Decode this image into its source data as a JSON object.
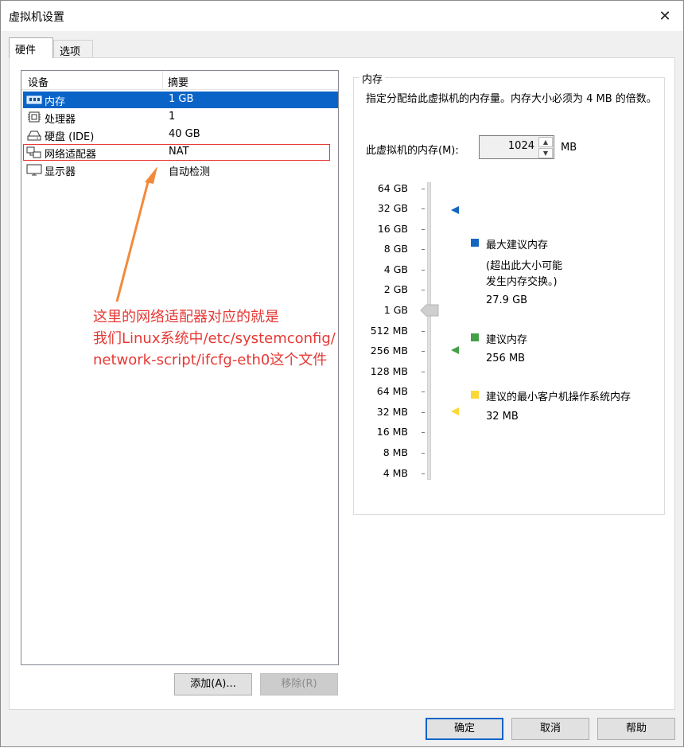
{
  "window": {
    "title": "虚拟机设置",
    "close_glyph": "✕"
  },
  "tabs": [
    {
      "label": "硬件",
      "active": true
    },
    {
      "label": "选项",
      "active": false
    }
  ],
  "device_list": {
    "headers": {
      "device": "设备",
      "summary": "摘要"
    },
    "rows": [
      {
        "icon": "memory-icon",
        "name": "内存",
        "summary": "1 GB",
        "selected": true
      },
      {
        "icon": "processor-icon",
        "name": "处理器",
        "summary": "1"
      },
      {
        "icon": "hard-disk-icon",
        "name": "硬盘 (IDE)",
        "summary": "40 GB"
      },
      {
        "icon": "network-adapter-icon",
        "name": "网络适配器",
        "summary": "NAT"
      },
      {
        "icon": "display-icon",
        "name": "显示器",
        "summary": "自动检测"
      }
    ],
    "add_button": "添加(A)...",
    "remove_button": "移除(R)"
  },
  "memory": {
    "group_title": "内存",
    "description": "指定分配给此虚拟机的内存量。内存大小必须为 4 MB 的倍数。",
    "label": "此虚拟机的内存(M):",
    "value": "1024",
    "unit": "MB",
    "scale": [
      "64 GB",
      "32 GB",
      "16 GB",
      "8 GB",
      "4 GB",
      "2 GB",
      "1 GB",
      "512 MB",
      "256 MB",
      "128 MB",
      "64 MB",
      "32 MB",
      "16 MB",
      "8 MB",
      "4 MB"
    ],
    "legend": {
      "max_title": "最大建议内存",
      "max_note_1": "(超出此大小可能",
      "max_note_2": "发生内存交换。)",
      "max_value": "27.9 GB",
      "rec_title": "建议内存",
      "rec_value": "256 MB",
      "min_title": "建议的最小客户机操作系统内存",
      "min_value": "32 MB"
    },
    "colors": {
      "max": "#1565c0",
      "rec": "#43a047",
      "min": "#fdd835"
    }
  },
  "annotation": {
    "line1": "这里的网络适配器对应的就是",
    "line2": "我们Linux系统中/etc/systemconfig/",
    "line3": "network-script/ifcfg-eth0这个文件",
    "color": "#e53935"
  },
  "footer": {
    "ok": "确定",
    "cancel": "取消",
    "help": "帮助"
  }
}
